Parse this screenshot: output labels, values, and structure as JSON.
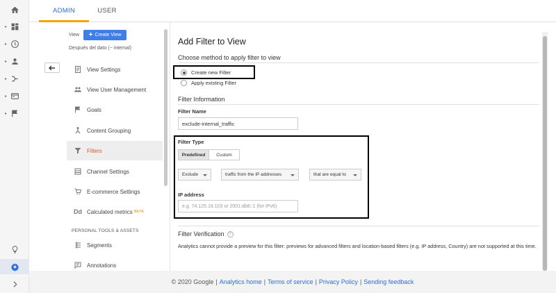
{
  "tabs": {
    "admin": "ADMIN",
    "user": "USER"
  },
  "view_panel": {
    "view_label": "View",
    "create_view": "Create View",
    "view_name": "Después del dato (− internal)",
    "items": [
      {
        "label": "View Settings",
        "icon": "document-icon"
      },
      {
        "label": "View User Management",
        "icon": "people-icon"
      },
      {
        "label": "Goals",
        "icon": "flag-icon"
      },
      {
        "label": "Content Grouping",
        "icon": "grouping-icon"
      },
      {
        "label": "Filters",
        "icon": "filter-icon"
      },
      {
        "label": "Channel Settings",
        "icon": "channel-icon"
      },
      {
        "label": "E-commerce Settings",
        "icon": "cart-icon"
      },
      {
        "label": "Calculated metrics",
        "icon": "dd-icon",
        "badge": "BETA"
      }
    ],
    "section_personal": "PERSONAL TOOLS & ASSETS",
    "personal_items": [
      {
        "label": "Segments",
        "icon": "segments-icon"
      },
      {
        "label": "Annotations",
        "icon": "annotation-icon"
      }
    ]
  },
  "main": {
    "title": "Add Filter to View",
    "method_heading": "Choose method to apply filter to view",
    "option_create": "Create new Filter",
    "option_apply": "Apply existing Filter",
    "filter_info_heading": "Filter Information",
    "filter_name_label": "Filter Name",
    "filter_name_value": "exclude-internal_traffic",
    "filter_type_label": "Filter Type",
    "type_predefined": "Predefined",
    "type_custom": "Custom",
    "select_exclude": "Exclude",
    "select_source": "traffic from the IP addresses",
    "select_condition": "that are equal to",
    "ip_label": "IP address",
    "ip_placeholder": "e.g. 74.125.19.103 or 2001:db8::1 (for IPv6)",
    "verification_heading": "Filter Verification",
    "verification_text": "Analytics cannot provide a preview for this filter: previews for advanced filters and location-based filters (e.g. IP address, Country) are not supported at this time."
  },
  "footer": {
    "copyright": "© 2020 Google",
    "links": [
      "Analytics home",
      "Terms of service",
      "Privacy Policy",
      "Sending feedback"
    ]
  },
  "colors": {
    "accent": "#2b6ce0",
    "tab_underline": "#f4a300",
    "active_menu": "#d45c2b",
    "button": "#3f7ee8"
  }
}
